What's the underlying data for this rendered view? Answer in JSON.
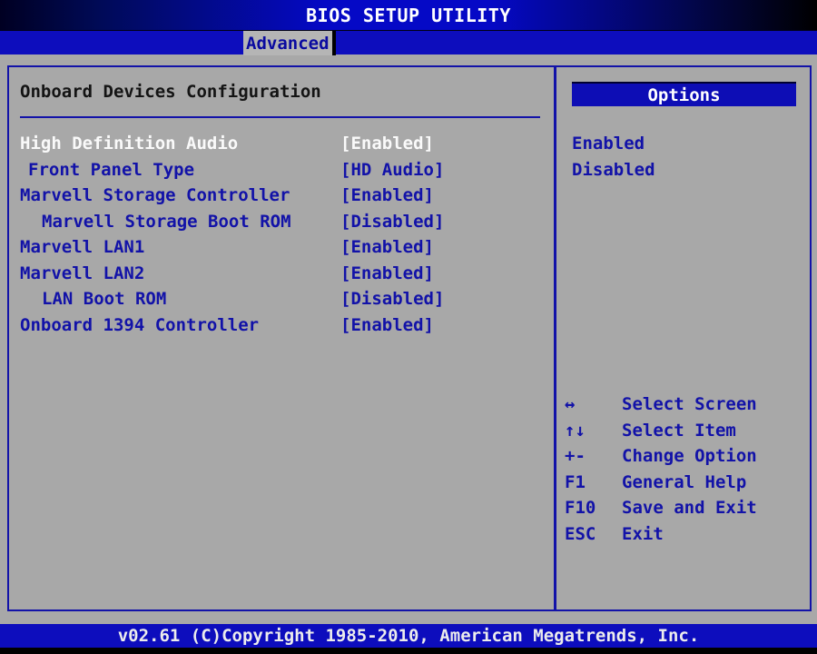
{
  "title_bar": {
    "title": "BIOS SETUP UTILITY"
  },
  "tab_bar": {
    "active_tab": "Advanced"
  },
  "main": {
    "section_title": "Onboard Devices Configuration",
    "items": [
      {
        "label": "High Definition Audio",
        "value": "[Enabled]",
        "indent": 0,
        "selected": true
      },
      {
        "label": "Front Panel Type",
        "value": "[HD Audio]",
        "indent": 1,
        "selected": false
      },
      {
        "label": "Marvell Storage Controller",
        "value": "[Enabled]",
        "indent": 0,
        "selected": false
      },
      {
        "label": "Marvell Storage Boot ROM",
        "value": "[Disabled]",
        "indent": 2,
        "selected": false
      },
      {
        "label": "Marvell LAN1",
        "value": "[Enabled]",
        "indent": 0,
        "selected": false
      },
      {
        "label": "Marvell LAN2",
        "value": "[Enabled]",
        "indent": 0,
        "selected": false
      },
      {
        "label": "LAN Boot ROM",
        "value": "[Disabled]",
        "indent": 2,
        "selected": false
      },
      {
        "label": "Onboard 1394 Controller",
        "value": "[Enabled]",
        "indent": 0,
        "selected": false
      }
    ]
  },
  "sidebar": {
    "options_title": "Options",
    "options": [
      "Enabled",
      "Disabled"
    ],
    "key_help": [
      {
        "key": "↔",
        "action": "Select Screen"
      },
      {
        "key": "↑↓",
        "action": "Select Item"
      },
      {
        "key": "+-",
        "action": "Change Option"
      },
      {
        "key": "F1",
        "action": "General Help"
      },
      {
        "key": "F10",
        "action": "Save and Exit"
      },
      {
        "key": "ESC",
        "action": "Exit"
      }
    ]
  },
  "footer": {
    "copyright": "v02.61 (C)Copyright 1985-2010, American Megatrends, Inc."
  },
  "colors": {
    "background_gray": "#a8a8a8",
    "bar_blue": "#0d0dbd",
    "text_blue": "#1212a8",
    "selected_text": "#fafafa",
    "title_text": "#ffffff"
  }
}
